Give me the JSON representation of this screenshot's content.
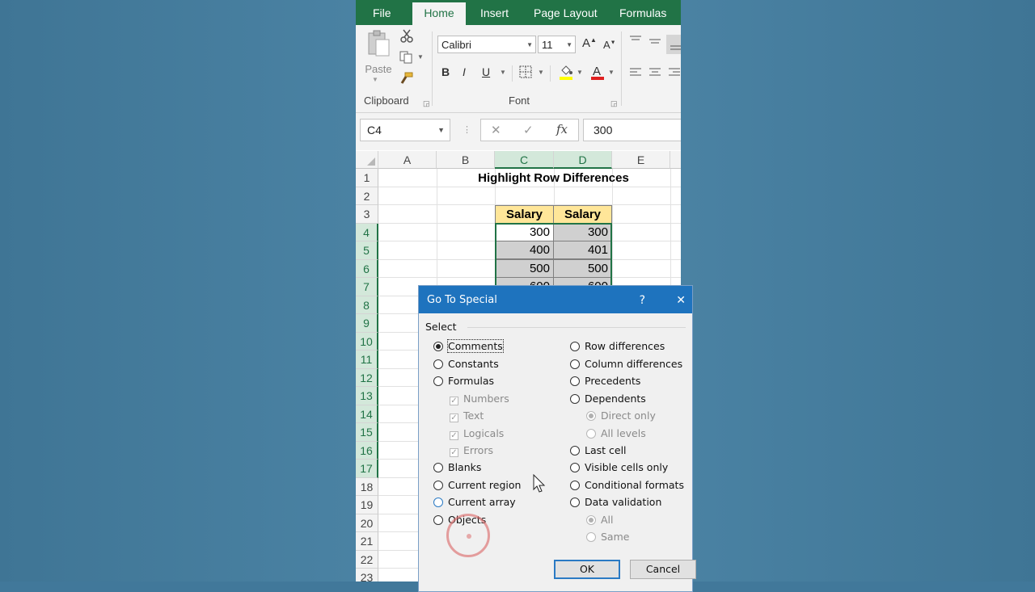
{
  "tabs": [
    "File",
    "Home",
    "Insert",
    "Page Layout",
    "Formulas"
  ],
  "ribbon": {
    "paste_label": "Paste",
    "clipboard_label": "Clipboard",
    "font_label": "Font",
    "font_name": "Calibri",
    "font_size": "11",
    "bold": "B",
    "italic": "I",
    "underline": "U"
  },
  "formula_bar": {
    "name_box": "C4",
    "value": "300"
  },
  "grid": {
    "columns": [
      "A",
      "B",
      "C",
      "D",
      "E"
    ],
    "rows": [
      "1",
      "2",
      "3",
      "4",
      "5",
      "6",
      "7",
      "8",
      "9",
      "10",
      "11",
      "12",
      "13",
      "14",
      "15",
      "16",
      "17",
      "18",
      "19",
      "20",
      "21",
      "22",
      "23"
    ],
    "title": "Highlight Row Differences",
    "headers": [
      "Salary",
      "Salary"
    ],
    "data": [
      [
        "300",
        "300"
      ],
      [
        "400",
        "401"
      ],
      [
        "500",
        "500"
      ],
      [
        "600",
        "600"
      ]
    ]
  },
  "dialog": {
    "title": "Go To Special",
    "help": "?",
    "close": "✕",
    "section": "Select",
    "left_options": [
      "Comments",
      "Constants",
      "Formulas",
      "Blanks",
      "Current region",
      "Current array",
      "Objects"
    ],
    "formula_sub": [
      "Numbers",
      "Text",
      "Logicals",
      "Errors"
    ],
    "right_options": [
      "Row differences",
      "Column differences",
      "Precedents",
      "Dependents",
      "Last cell",
      "Visible cells only",
      "Conditional formats",
      "Data validation"
    ],
    "dependents_sub": [
      "Direct only",
      "All levels"
    ],
    "validation_sub": [
      "All",
      "Same"
    ],
    "ok": "OK",
    "cancel": "Cancel"
  },
  "colors": {
    "excel_green": "#217346",
    "dialog_blue": "#1e73be",
    "header_fill": "#ffe699"
  }
}
